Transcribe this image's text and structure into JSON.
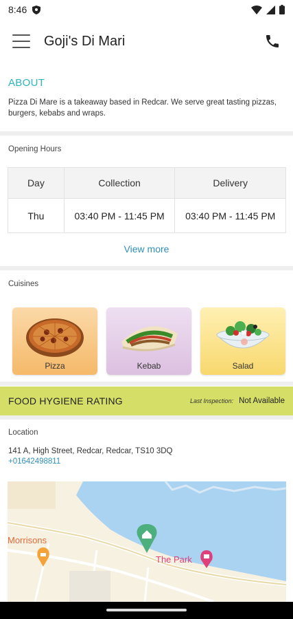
{
  "status_bar": {
    "time": "8:46"
  },
  "app_bar": {
    "title": "Goji's Di Mari"
  },
  "about": {
    "title": "ABOUT",
    "text": "Pizza Di Mare is a takeaway based in Redcar. We serve great tasting pizzas, burgers, kebabs and wraps."
  },
  "opening_hours": {
    "label": "Opening Hours",
    "headers": [
      "Day",
      "Collection",
      "Delivery"
    ],
    "rows": [
      {
        "day": "Thu",
        "collection": "03:40 PM - 11:45 PM",
        "delivery": "03:40 PM - 11:45 PM"
      }
    ],
    "view_more": "View more"
  },
  "cuisines": {
    "label": "Cuisines",
    "items": [
      {
        "name": "Pizza",
        "icon": "pizza-icon"
      },
      {
        "name": "Kebab",
        "icon": "kebab-icon"
      },
      {
        "name": "Salad",
        "icon": "salad-icon"
      }
    ]
  },
  "hygiene": {
    "title": "FOOD HYGIENE RATING",
    "last_inspection_label": "Last Inspection:",
    "last_inspection_value": "Not Available"
  },
  "location": {
    "label": "Location",
    "address": "141 A, High Street, Redcar, Redcar, TS10 3DQ",
    "phone": "+01642498811",
    "map_labels": {
      "morrisons": "Morrisons",
      "park": "The Park"
    }
  },
  "colors": {
    "accent": "#2bb5c2",
    "link": "#2f8fb8",
    "hygiene_bar": "#d5de67",
    "map_water": "#aad3f2",
    "map_marker": "#4caf7d"
  }
}
